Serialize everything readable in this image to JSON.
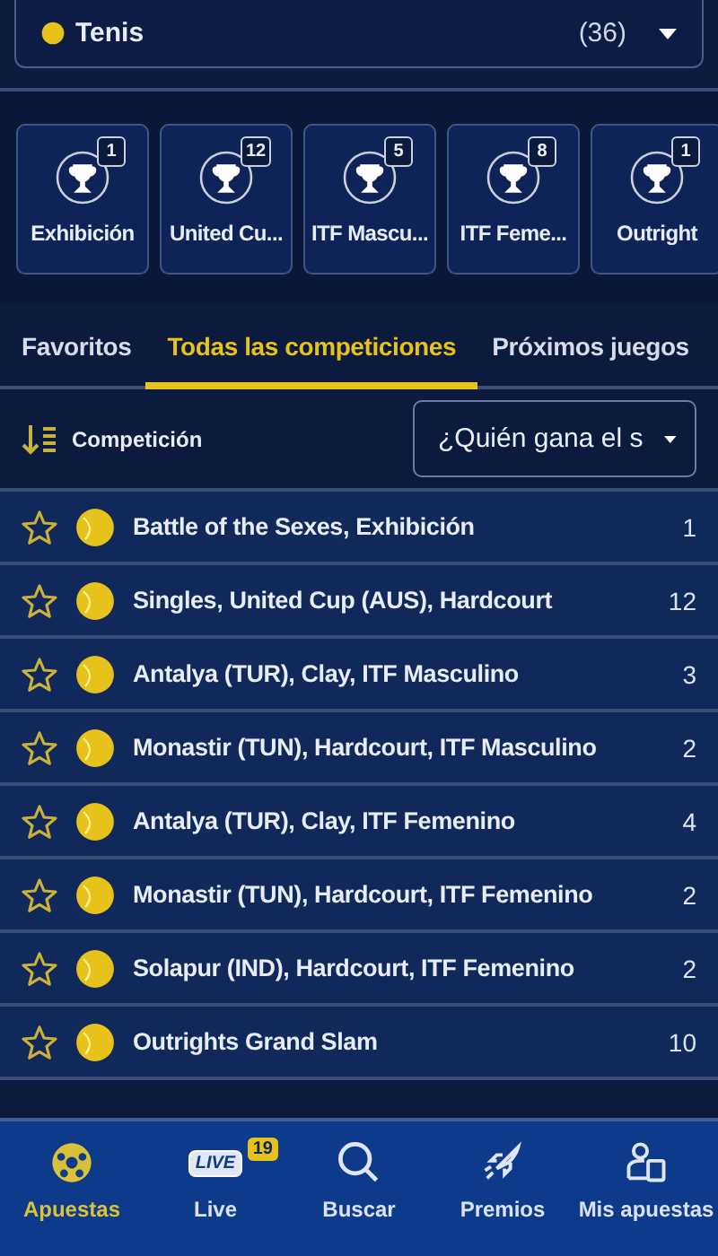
{
  "sport_select": {
    "label": "Tenis",
    "count": "(36)"
  },
  "competitions": [
    {
      "label": "Exhibición",
      "count": "1"
    },
    {
      "label": "United Cu...",
      "count": "12"
    },
    {
      "label": "ITF Mascu...",
      "count": "5"
    },
    {
      "label": "ITF Feme...",
      "count": "8"
    },
    {
      "label": "Outright",
      "count": "1"
    }
  ],
  "tabs": [
    {
      "label": "Favoritos",
      "selected": false
    },
    {
      "label": "Todas las competiciones",
      "selected": true
    },
    {
      "label": "Próximos juegos",
      "selected": false
    }
  ],
  "sort": {
    "label": "Competición"
  },
  "market_select": {
    "value": "¿Quién gana el s"
  },
  "rows": [
    {
      "name": "Battle of the Sexes, Exhibición",
      "count": "1",
      "favorite": false
    },
    {
      "name": "Singles, United Cup (AUS), Hardcourt",
      "count": "12",
      "favorite": false
    },
    {
      "name": "Antalya (TUR), Clay, ITF Masculino",
      "count": "3",
      "favorite": false
    },
    {
      "name": "Monastir (TUN), Hardcourt, ITF Masculino",
      "count": "2",
      "favorite": false
    },
    {
      "name": "Antalya (TUR), Clay, ITF Femenino",
      "count": "4",
      "favorite": false
    },
    {
      "name": "Monastir (TUN), Hardcourt, ITF Femenino",
      "count": "2",
      "favorite": false
    },
    {
      "name": "Solapur (IND), Hardcourt, ITF Femenino",
      "count": "2",
      "favorite": false
    },
    {
      "name": "Outrights Grand Slam",
      "count": "10",
      "favorite": false
    }
  ],
  "bottom_nav": [
    {
      "kind": "ball",
      "label": "Apuestas",
      "selected": true
    },
    {
      "kind": "live",
      "label": "Live",
      "icon_text": "LIVE",
      "badge": "19",
      "selected": false
    },
    {
      "kind": "search",
      "label": "Buscar",
      "selected": false
    },
    {
      "kind": "rocket",
      "label": "Premios",
      "selected": false
    },
    {
      "kind": "slip",
      "label": "Mis apuestas",
      "selected": false
    }
  ]
}
